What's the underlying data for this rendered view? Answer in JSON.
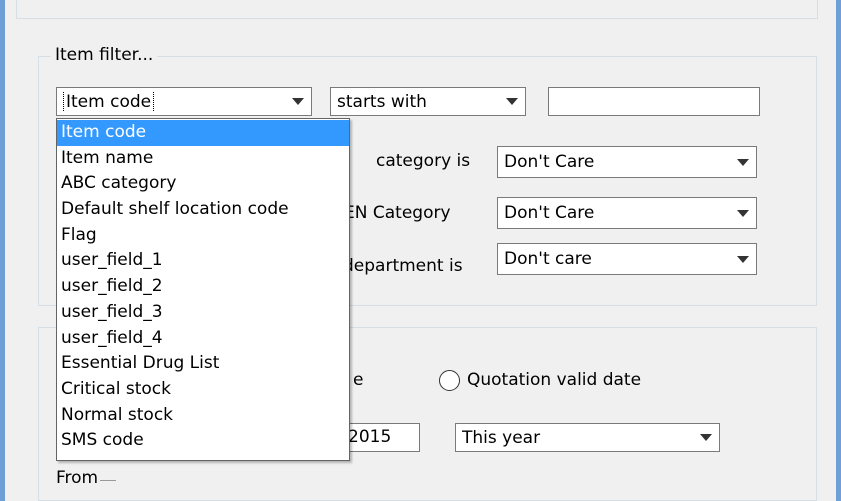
{
  "item_filter": {
    "group_title": "Item filter...",
    "field_select": {
      "value": "Item code"
    },
    "operator_select": {
      "value": "starts with"
    },
    "search_value": "",
    "dropdown_options": [
      "Item code",
      "Item name",
      "ABC category",
      "Default shelf location code",
      "Flag",
      "user_field_1",
      "user_field_2",
      "user_field_3",
      "user_field_4",
      "Essential Drug List",
      "Critical stock",
      "Normal stock",
      "SMS code"
    ],
    "selected_option_index": 0,
    "category": {
      "label": "category is",
      "value": "Don't Care"
    },
    "ven_category": {
      "label": "EN Category",
      "value": "Don't Care"
    },
    "department": {
      "label": "department is",
      "value": "Don't care"
    }
  },
  "date_section": {
    "radio_partial_label": "e",
    "quotation_radio_label": "Quotation valid date",
    "year_input_value": "2015",
    "period_select": {
      "value": "This year"
    },
    "from_label": "From"
  },
  "colors": {
    "window_border": "#6e9fd5",
    "panel_background": "#f0f0f0",
    "selection_highlight": "#3399ff"
  }
}
